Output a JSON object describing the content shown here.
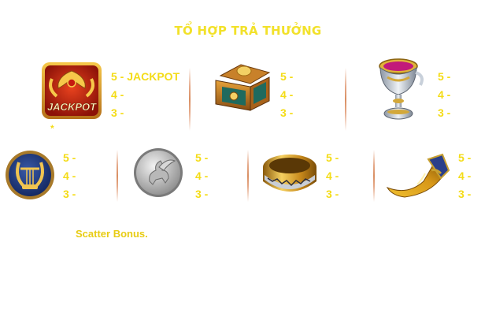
{
  "header": {
    "title": "TỔ HỢP TRẢ THƯỞNG"
  },
  "symbols_top": [
    {
      "icon": "jackpot-icon",
      "badge": "JACKPOT",
      "pays": [
        "5 - JACKPOT",
        "4 -",
        "3 -"
      ]
    },
    {
      "icon": "treasure-chest-icon",
      "pays": [
        "5 -",
        "4 -",
        "3 -"
      ]
    },
    {
      "icon": "silver-chalice-icon",
      "pays": [
        "5 -",
        "4 -",
        "3 -"
      ]
    }
  ],
  "symbols_bottom": [
    {
      "icon": "lyre-coin-icon",
      "pays": [
        "5 -",
        "4 -",
        "3 -"
      ]
    },
    {
      "icon": "pegasus-coin-icon",
      "pays": [
        "5 -",
        "4 -",
        "3 -"
      ]
    },
    {
      "icon": "gold-ring-icon",
      "pays": [
        "5 -",
        "4 -",
        "3 -"
      ]
    },
    {
      "icon": "horn-icon",
      "pays": [
        "5 -",
        "4 -",
        "3 -"
      ]
    }
  ],
  "footnote": {
    "marker": "*"
  },
  "description": {
    "line1": "",
    "bonus_label": "Scatter Bonus.",
    "line2_rest": ""
  },
  "colors": {
    "accent_yellow": "#f4dc17",
    "title_yellow": "#f2e12a",
    "divider": "#d98f63"
  }
}
